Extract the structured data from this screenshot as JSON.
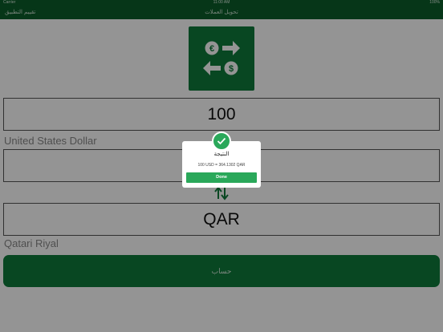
{
  "status_bar": {
    "carrier": "Carrier",
    "time": "11:00 AM",
    "battery": "100%"
  },
  "nav": {
    "title": "تحويل العملات",
    "rate_label": "تقييم التطبيق"
  },
  "amount": {
    "value": "100"
  },
  "from_currency": {
    "code": "",
    "name": "United States Dollar"
  },
  "to_currency": {
    "code": "QAR",
    "name": "Qatari Riyal"
  },
  "calculate_button": {
    "label": "حساب"
  },
  "result_dialog": {
    "title": "النتيجة",
    "message": "100 USD = 364.1302 QAR",
    "done_label": "Done"
  },
  "colors": {
    "primary": "#0f7a3b",
    "accent": "#2aa85a",
    "nav": "#0b5e2a"
  },
  "icons": {
    "logo": "currency-exchange-icon",
    "swap": "swap-vertical-icon",
    "check": "checkmark-icon"
  }
}
